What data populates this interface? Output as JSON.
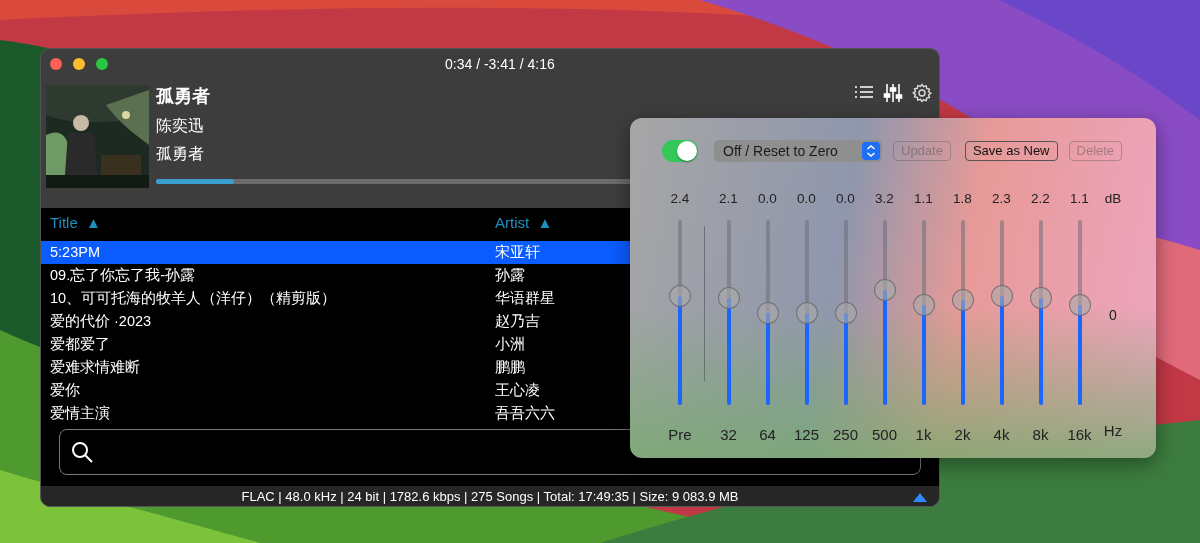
{
  "window": {
    "time": "0:34 / -3:41 / 4:16"
  },
  "now_playing": {
    "title": "孤勇者",
    "artist": "陈奕迅",
    "album": "孤勇者",
    "level": 0.1
  },
  "toolbar": [
    {
      "kind": "playlist"
    },
    {
      "kind": "equalizer"
    },
    {
      "kind": "settings"
    }
  ],
  "table": {
    "columns": [
      {
        "label": "Title",
        "sort": "▲"
      },
      {
        "label": "Artist",
        "sort": "▲"
      }
    ],
    "rows": [
      {
        "title": "5:23PM",
        "artist": "宋亚轩",
        "selected": true
      },
      {
        "title": "09.忘了你忘了我-孙露",
        "artist": "孙露",
        "selected": false
      },
      {
        "title": "10、可可托海的牧羊人（洋仔）（精剪版）",
        "artist": "华语群星",
        "selected": false
      },
      {
        "title": "爱的代价 ·2023",
        "artist": "赵乃吉",
        "selected": false
      },
      {
        "title": "爱都爱了",
        "artist": "小洲",
        "selected": false
      },
      {
        "title": "爱难求情难断",
        "artist": "鹏鹏",
        "selected": false
      },
      {
        "title": "爱你",
        "artist": "王心凌",
        "selected": false
      },
      {
        "title": "爱情主演",
        "artist": "吾吾六六",
        "selected": false
      }
    ]
  },
  "status_bar": {
    "text": "FLAC | 48.0 kHz | 24 bit | 1782.6 kbps | 275 Songs | Total: 17:49:35 | Size: 9 083.9 MB"
  },
  "equalizer": {
    "enabled": true,
    "preset": "Off / Reset to Zero",
    "buttons": [
      {
        "label": "Update",
        "disabled": true
      },
      {
        "label": "Save as New",
        "disabled": false
      },
      {
        "label": "Delete",
        "disabled": true
      }
    ],
    "unit_db": "dB",
    "zero_label": "0",
    "unit_hz": "Hz",
    "bands": [
      {
        "value": "2.4",
        "label": "Pre",
        "level": 0.59
      },
      {
        "value": "2.1",
        "label": "32",
        "level": 0.58
      },
      {
        "value": "0.0",
        "label": "64",
        "level": 0.5
      },
      {
        "value": "0.0",
        "label": "125",
        "level": 0.5
      },
      {
        "value": "0.0",
        "label": "250",
        "level": 0.5
      },
      {
        "value": "3.2",
        "label": "500",
        "level": 0.62
      },
      {
        "value": "1.1",
        "label": "1k",
        "level": 0.54
      },
      {
        "value": "1.8",
        "label": "2k",
        "level": 0.57
      },
      {
        "value": "2.3",
        "label": "4k",
        "level": 0.59
      },
      {
        "value": "2.2",
        "label": "8k",
        "level": 0.58
      },
      {
        "value": "1.1",
        "label": "16k",
        "level": 0.54
      }
    ]
  }
}
